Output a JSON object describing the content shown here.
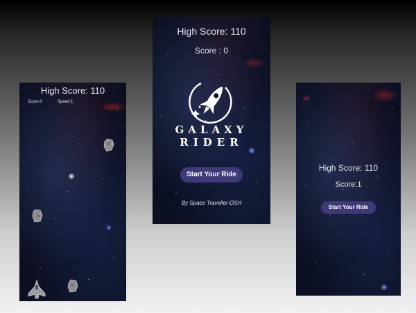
{
  "gameplay": {
    "high_score": "High Score: 110",
    "score": "Score:0",
    "speed": "Speed:1",
    "player_icon": "spaceship-icon",
    "asteroid_icon": "asteroid-icon"
  },
  "menu": {
    "high_score": "High Score: 110",
    "score": "Score : 0",
    "logo_line1": "GALAXY",
    "logo_line2": "RIDER",
    "logo_icon": "rocket-icon",
    "start_button": "Start Your Ride",
    "credit": "By Space Traveller OSH"
  },
  "game_over": {
    "high_score": "High Score: 110",
    "score": "Score:1",
    "start_button": "Start Your Ride"
  },
  "colors": {
    "button": "#3e3a78",
    "space_background": "#0b0f22",
    "text": "#e6e6ee"
  }
}
